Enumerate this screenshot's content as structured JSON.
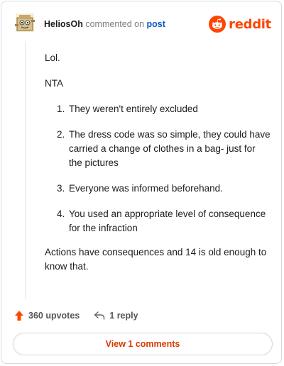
{
  "header": {
    "username": "HeliosOh",
    "action_text": "commented on",
    "post_link": "post",
    "logo_text": "reddit"
  },
  "comment": {
    "paragraph1": "Lol.",
    "paragraph2": "NTA",
    "list": [
      "They weren't entirely excluded",
      "The dress code was so simple, they could have carried a change of clothes in a bag- just for the pictures",
      "Everyone was informed beforehand.",
      "You used an appropriate level of consequence for the infraction"
    ],
    "paragraph3": "Actions have consequences and 14 is old enough to know that."
  },
  "actions": {
    "upvotes": "360 upvotes",
    "replies": "1 reply"
  },
  "footer": {
    "view_comments": "View 1 comments"
  },
  "colors": {
    "accent": "#ff4500",
    "link": "#0a56c2",
    "button_text": "#d93a00"
  },
  "icons": {
    "avatar": "snoo-avatar",
    "logo": "reddit-snoo-icon",
    "upvote": "upvote-arrow-icon",
    "reply": "reply-arrow-icon"
  }
}
